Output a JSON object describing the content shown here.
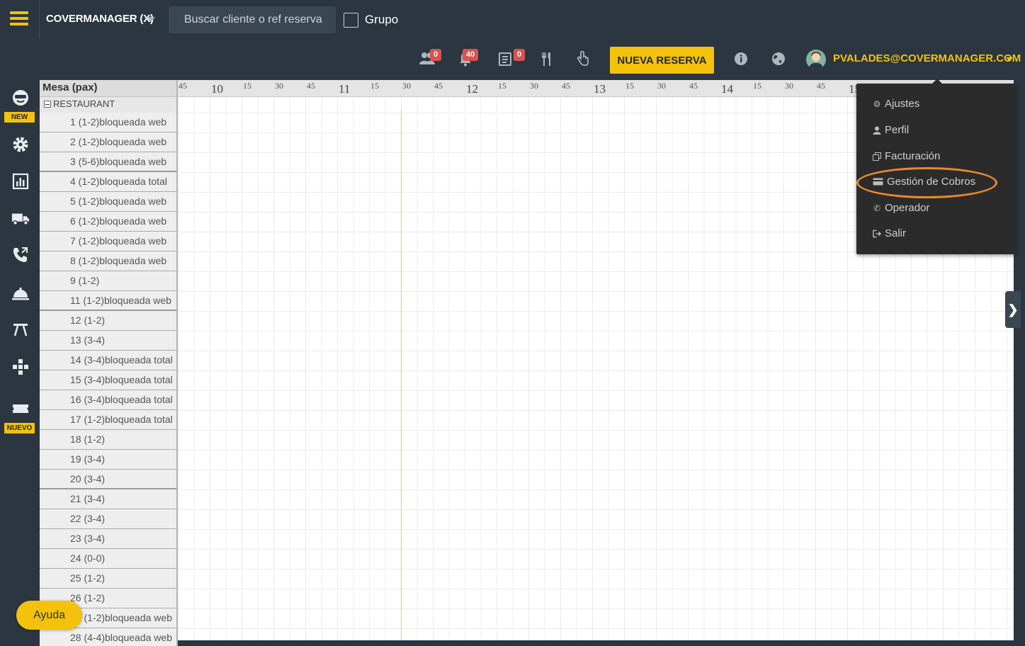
{
  "topbar": {
    "brand": "COVERMANAGER (X)",
    "search_placeholder": "Buscar cliente o ref reserva",
    "grupo_label": "Grupo",
    "badges": {
      "people": "0",
      "bell": "40",
      "list": "0"
    },
    "nueva_reserva": "NUEVA RESERVA",
    "user_email": "PVALADES@COVERMANAGER.COM"
  },
  "sidebar": {
    "new_label": "NEW",
    "nuevo_label": "NUEVO"
  },
  "table": {
    "header": "Mesa (pax)",
    "group": "RESTAURANT",
    "rows": [
      "1 (1-2)bloqueada web",
      "2 (1-2)bloqueada web",
      "3 (5-6)bloqueada web",
      "4 (1-2)bloqueada total",
      "5 (1-2)bloqueada web",
      "6 (1-2)bloqueada web",
      "7 (1-2)bloqueada web",
      "8 (1-2)bloqueada web",
      "9 (1-2)",
      "11 (1-2)bloqueada web",
      "12 (1-2)",
      "13 (3-4)",
      "14 (3-4)bloqueada total",
      "15 (3-4)bloqueada total",
      "16 (3-4)bloqueada total",
      "17 (1-2)bloqueada total",
      "18 (1-2)",
      "19 (3-4)",
      "20 (3-4)",
      "21 (3-4)",
      "22 (3-4)",
      "23 (3-4)",
      "24 (0-0)",
      "25 (1-2)",
      "26 (1-2)",
      "27 (1-2)bloqueada web",
      "28 (4-4)bloqueada web"
    ]
  },
  "timeline": {
    "hours": [
      "10",
      "11",
      "12",
      "13",
      "14",
      "15"
    ],
    "minutes": [
      "15",
      "30",
      "45"
    ],
    "first_minute": "45"
  },
  "menu": {
    "items": [
      "Ajustes",
      "Perfil",
      "Facturación",
      "Gestión de Cobros",
      "Operador",
      "Salir"
    ]
  },
  "help": {
    "label": "Ayuda"
  }
}
